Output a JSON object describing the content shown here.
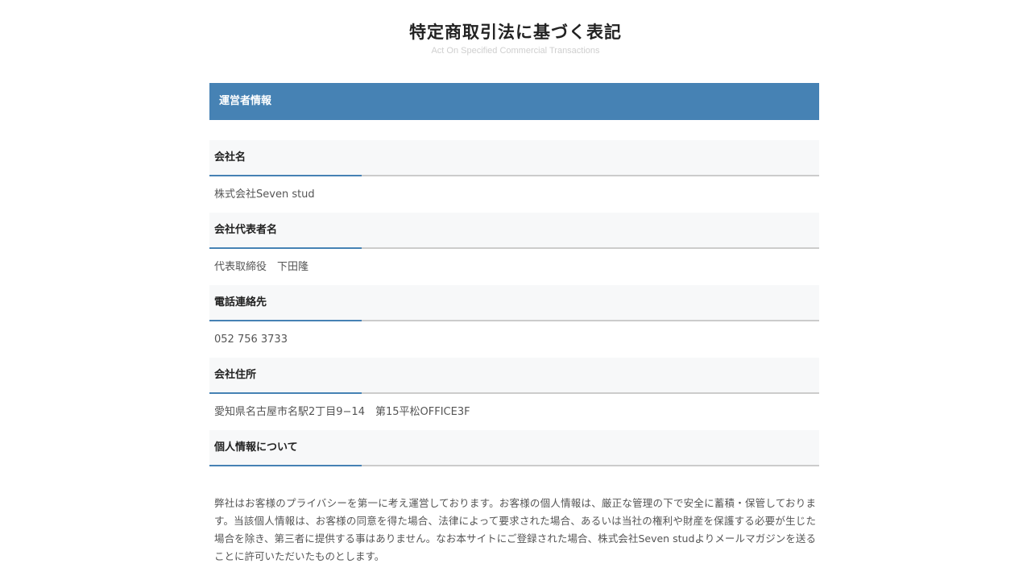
{
  "header": {
    "title": "特定商取引法に基づく表記",
    "subtitle": "Act On Specified Commercial Transactions"
  },
  "section": {
    "title": "運営者情報"
  },
  "rows": [
    {
      "label": "会社名",
      "value": "株式会社Seven stud"
    },
    {
      "label": "会社代表者名",
      "value": "代表取締役　下田隆"
    },
    {
      "label": "電話連絡先",
      "value": "052 756 3733"
    },
    {
      "label": "会社住所",
      "value": "愛知県名古屋市名駅2丁目9−14　第15平松OFFICE3F"
    }
  ],
  "privacy": {
    "label": "個人情報について",
    "text": "弊社はお客様のプライバシーを第一に考え運営しております。お客様の個人情報は、厳正な管理の下で安全に蓄積・保管しております。当該個人情報は、お客様の同意を得た場合、法律によって要求された場合、あるいは当社の権利や財産を保護する必要が生じた場合を除き、第三者に提供する事はありません。なお本サイトにご登録された場合、株式会社Seven studよりメールマガジンを送ることに許可いただいたものとします。"
  },
  "colors": {
    "accent": "#4682b4",
    "row_background": "#f7f8f9",
    "divider": "#cccccc"
  }
}
